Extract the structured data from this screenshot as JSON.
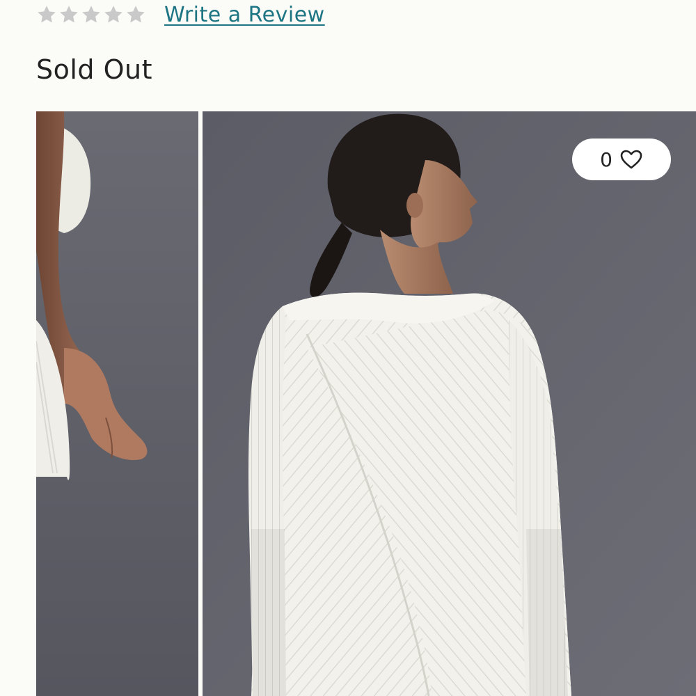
{
  "rating": {
    "stars": 5,
    "filled": 0,
    "star_color": "#c9c9c9",
    "icon": "star-icon"
  },
  "review": {
    "link_label": "Write a Review",
    "link_color": "#1d7583"
  },
  "status": {
    "label": "Sold Out"
  },
  "gallery": {
    "like_count": "0",
    "like_icon": "heart-outline-icon"
  }
}
